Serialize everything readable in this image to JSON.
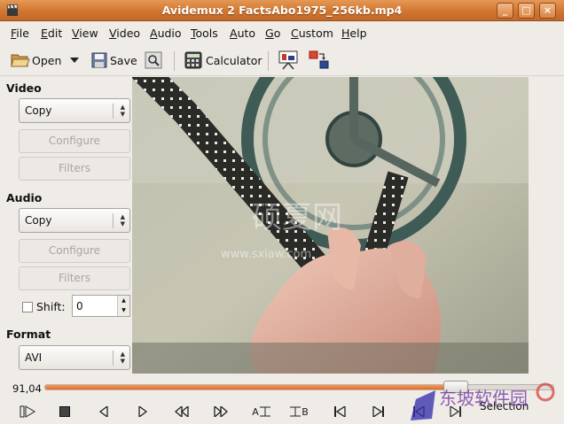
{
  "window": {
    "title": "Avidemux 2 FactsAbo1975_256kb.mp4",
    "buttons": [
      "_",
      "□",
      "×"
    ]
  },
  "menu": [
    "File",
    "Edit",
    "View",
    "Video",
    "Audio",
    "Tools",
    "Auto",
    "Go",
    "Custom",
    "Help"
  ],
  "toolbar": {
    "open_label": "Open",
    "save_label": "Save",
    "calculator_label": "Calculator"
  },
  "video_section": {
    "label": "Video",
    "codec": "Copy",
    "configure_label": "Configure",
    "filters_label": "Filters"
  },
  "audio_section": {
    "label": "Audio",
    "codec": "Copy",
    "configure_label": "Configure",
    "filters_label": "Filters",
    "shift_label": "Shift:",
    "shift_value": "0"
  },
  "format_section": {
    "label": "Format",
    "value": "AVI"
  },
  "timeline": {
    "position_label": "91,04",
    "position_fraction": 0.79
  },
  "transport": {
    "a_label": "A",
    "b_label": "B",
    "selection_label": "Selection"
  },
  "overlay_text": {
    "center_logo": "硕夏网",
    "center_url": "www.sxiaw.com",
    "corner_logo": "东坡软件园"
  },
  "colors": {
    "titlebar": "#d2762f",
    "progress_fill": "#e06f27",
    "window_bg": "#efebe7"
  }
}
